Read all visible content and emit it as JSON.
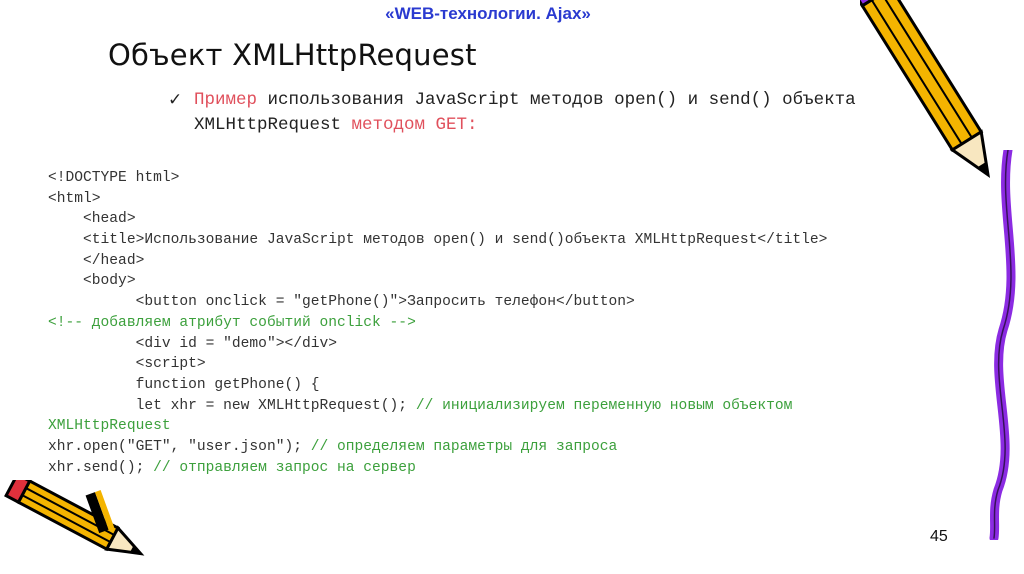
{
  "header": {
    "text": "«WEB-технологии. Ajax»"
  },
  "slide": {
    "title": "Объект XMLHttpRequest",
    "page_number": "45"
  },
  "bullet": {
    "part1_red": "Пример",
    "part2": " использования JavaScript методов open() и send() объекта XMLHttpRequest ",
    "part3_red": "методом GET:"
  },
  "code": {
    "l1": "<!DOCTYPE html>",
    "l2": "<html>",
    "l3": "    <head>",
    "l4": "    <title>Использование JavaScript методов open() и send()объекта XMLHttpRequest</title>",
    "l5": "    </head>",
    "l6": "    <body>",
    "l7": "          <button onclick = \"getPhone()\">Запросить телефон</button>",
    "l8": "<!-- добавляем атрибут событий onclick -->",
    "l9": "          <div id = \"demo\"></div>",
    "l10": "          <script>",
    "l11": "          function getPhone() {",
    "l12_code": "          let xhr = new XMLHttpRequest(); ",
    "l12_comment": "// инициализируем переменную новым объектом",
    "l13_comment": "XMLHttpRequest",
    "l14_code": "xhr.open(\"GET\", \"user.json\"); ",
    "l14_comment": "// определяем параметры для запроса",
    "l15_code": "xhr.send(); ",
    "l15_comment": "// отправляем запрос на сервер"
  },
  "colors": {
    "header": "#2a3ad0",
    "accent_red": "#e0505c",
    "comment_green": "#3ca03c",
    "pencil_yellow": "#f4b400",
    "ribbon_purple": "#8b2be2"
  },
  "icons": [
    "check-icon",
    "pencil-icon",
    "pencil-icon",
    "ribbon-decoration"
  ]
}
